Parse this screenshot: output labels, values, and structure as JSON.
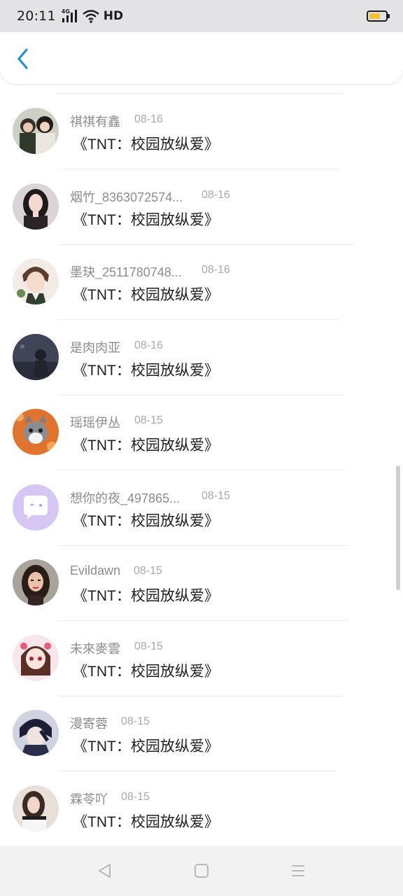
{
  "status_bar": {
    "time": "20:11",
    "network_tag": "4G",
    "hd_label": "HD",
    "battery_color": "#f4c430",
    "battery_level": 0.7
  },
  "header": {
    "back_icon": "chevron-left-icon",
    "accent_color": "#1e8fd6"
  },
  "list": {
    "items": [
      {
        "name": "祺祺有鑫",
        "date": "08-16",
        "title": "《TNT：校园放纵爱》",
        "avatar": "two-boys-photo"
      },
      {
        "name": "烟竹_8363072574...",
        "date": "08-16",
        "title": "《TNT：校园放纵爱》",
        "avatar": "girl-photo"
      },
      {
        "name": "墨玦_2511780748...",
        "date": "08-16",
        "title": "《TNT：校园放纵爱》",
        "avatar": "anime-boy"
      },
      {
        "name": "是肉肉亚",
        "date": "08-16",
        "title": "《TNT：校园放纵爱》",
        "avatar": "dusk-figure"
      },
      {
        "name": "瑶瑶伊丛",
        "date": "08-15",
        "title": "《TNT：校园放纵爱》",
        "avatar": "cat-photo"
      },
      {
        "name": "想你的夜_497865...",
        "date": "08-15",
        "title": "《TNT：校园放纵爱》",
        "avatar": "chat-bubble-default"
      },
      {
        "name": "Evildawn",
        "date": "08-15",
        "title": "《TNT：校园放纵爱》",
        "avatar": "illustrated-girl"
      },
      {
        "name": "未來麥雲",
        "date": "08-15",
        "title": "《TNT：校园放纵爱》",
        "avatar": "anime-girl-pink"
      },
      {
        "name": "漫寄蓉",
        "date": "08-15",
        "title": "《TNT：校园放纵爱》",
        "avatar": "anime-boy-dark"
      },
      {
        "name": "霖苓吖",
        "date": "08-15",
        "title": "《TNT：校园放纵爱》",
        "avatar": "girl-photo-2"
      }
    ]
  },
  "nav_bar": {
    "back": "triangle-back-icon",
    "home": "square-home-icon",
    "menu": "menu-lines-icon"
  }
}
